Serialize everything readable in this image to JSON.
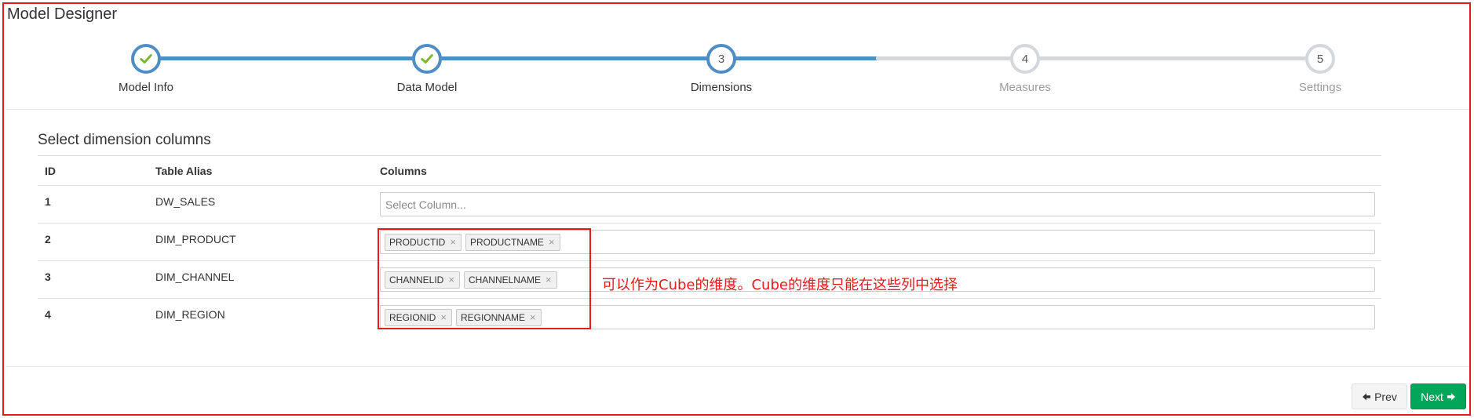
{
  "page": {
    "title": "Model Designer"
  },
  "wizard": {
    "steps": [
      {
        "label": "Model Info",
        "status": "done",
        "indicator": "check-icon"
      },
      {
        "label": "Data Model",
        "status": "done",
        "indicator": "check-icon"
      },
      {
        "label": "Dimensions",
        "status": "current",
        "number": "3"
      },
      {
        "label": "Measures",
        "status": "todo",
        "number": "4"
      },
      {
        "label": "Settings",
        "status": "todo",
        "number": "5"
      }
    ]
  },
  "section": {
    "title": "Select dimension columns"
  },
  "table": {
    "headers": {
      "id": "ID",
      "alias": "Table Alias",
      "columns": "Columns"
    },
    "rows": [
      {
        "id": "1",
        "alias": "DW_SALES",
        "placeholder": "Select Column...",
        "tags": []
      },
      {
        "id": "2",
        "alias": "DIM_PRODUCT",
        "tags": [
          "PRODUCTID",
          "PRODUCTNAME"
        ]
      },
      {
        "id": "3",
        "alias": "DIM_CHANNEL",
        "tags": [
          "CHANNELID",
          "CHANNELNAME"
        ]
      },
      {
        "id": "4",
        "alias": "DIM_REGION",
        "tags": [
          "REGIONID",
          "REGIONNAME"
        ]
      }
    ],
    "tag_remove_symbol": "×"
  },
  "annotation": {
    "text": "可以作为Cube的维度。Cube的维度只能在这些列中选择"
  },
  "buttons": {
    "prev_label": "Prev",
    "next_label": "Next"
  },
  "colors": {
    "step_done": "#4f8ec5",
    "step_todo": "#d4d7dc",
    "check": "#7cb82f",
    "next_button": "#00a65a",
    "annotation": "#e8191a"
  }
}
